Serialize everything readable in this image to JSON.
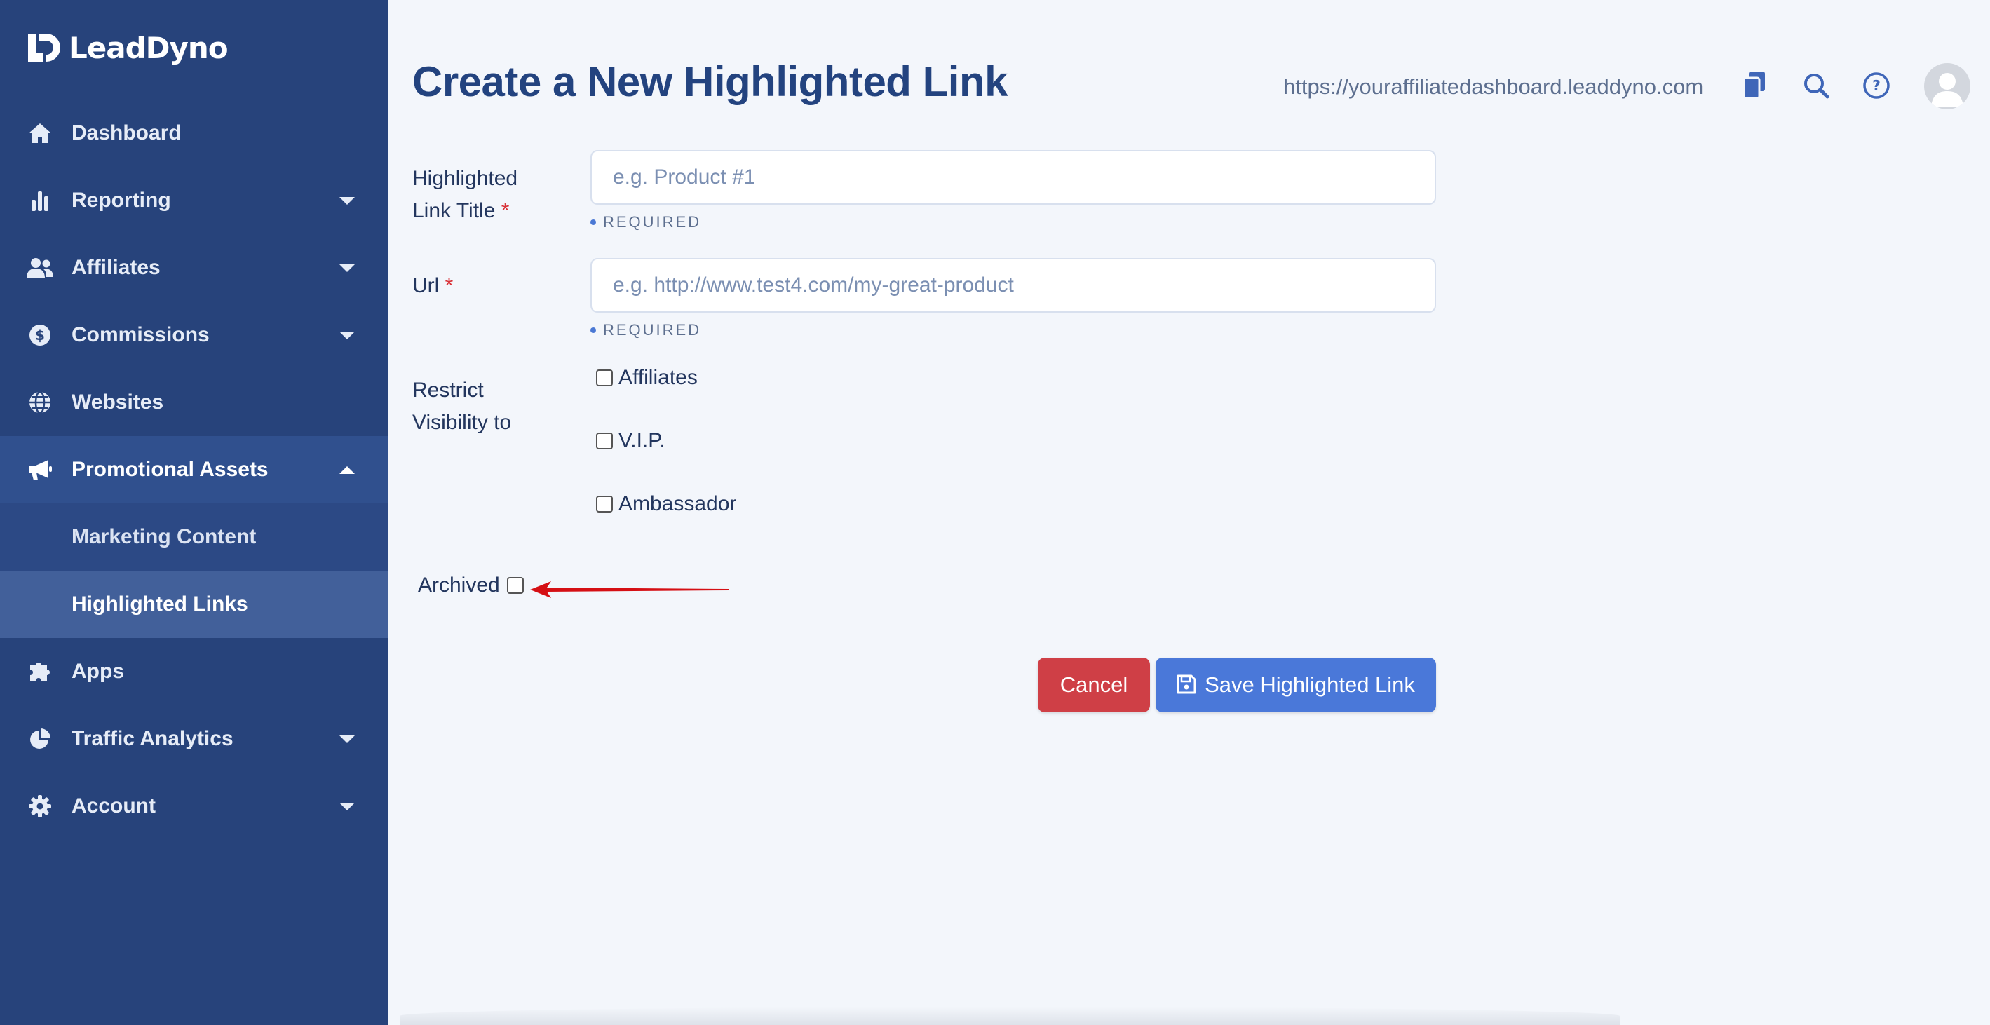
{
  "brand": {
    "name": "LeadDyno"
  },
  "sidebar": {
    "items": [
      {
        "label": "Dashboard",
        "icon": "home-icon",
        "has_caret": false
      },
      {
        "label": "Reporting",
        "icon": "bar-chart-icon",
        "has_caret": true
      },
      {
        "label": "Affiliates",
        "icon": "users-icon",
        "has_caret": true
      },
      {
        "label": "Commissions",
        "icon": "dollar-icon",
        "has_caret": true
      },
      {
        "label": "Websites",
        "icon": "globe-icon",
        "has_caret": false
      },
      {
        "label": "Promotional Assets",
        "icon": "megaphone-icon",
        "has_caret": true,
        "expanded": true,
        "children": [
          {
            "label": "Marketing Content"
          },
          {
            "label": "Highlighted Links",
            "selected": true
          }
        ]
      },
      {
        "label": "Apps",
        "icon": "puzzle-icon",
        "has_caret": false
      },
      {
        "label": "Traffic Analytics",
        "icon": "pie-chart-icon",
        "has_caret": true
      },
      {
        "label": "Account",
        "icon": "gear-icon",
        "has_caret": true
      }
    ]
  },
  "header": {
    "title": "Create a New Highlighted Link",
    "dashboard_url": "https://youraffiliatedashboard.leaddyno.com",
    "icons": [
      "copy-icon",
      "search-icon",
      "help-icon",
      "avatar"
    ]
  },
  "form": {
    "title_field": {
      "label_line1": "Highlighted",
      "label_line2": "Link Title",
      "required_mark": "*",
      "placeholder": "e.g. Product #1",
      "value": "",
      "note": "REQUIRED"
    },
    "url_field": {
      "label": "Url",
      "required_mark": "*",
      "placeholder": "e.g. http://www.test4.com/my-great-product",
      "value": "",
      "note": "REQUIRED"
    },
    "visibility": {
      "label_line1": "Restrict",
      "label_line2": "Visibility to",
      "options": [
        {
          "label": "Affiliates",
          "checked": false
        },
        {
          "label": "V.I.P.",
          "checked": false
        },
        {
          "label": "Ambassador",
          "checked": false
        }
      ]
    },
    "archived": {
      "label": "Archived",
      "checked": false
    },
    "cancel_label": "Cancel",
    "save_label": "Save Highlighted Link"
  },
  "colors": {
    "sidebar": "#27437b",
    "title": "#23437f",
    "cancel": "#cf3f46",
    "save": "#4a78d9",
    "annotation_arrow": "#d50f14"
  }
}
